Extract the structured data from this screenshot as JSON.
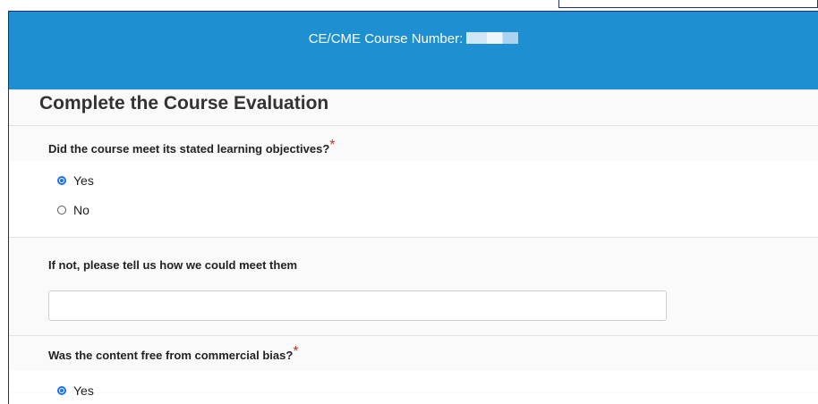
{
  "banner": {
    "course_number_label": "CE/CME Course Number:",
    "course_number_value": "",
    "course_title": ""
  },
  "evaluation": {
    "title": "Complete the Course Evaluation",
    "questions": [
      {
        "label": "Did the course meet its stated learning objectives?",
        "required_mark": "*",
        "options": [
          {
            "label": "Yes",
            "selected": true
          },
          {
            "label": "No",
            "selected": false
          }
        ]
      },
      {
        "label": "If not, please tell us how we could meet them",
        "input_value": "",
        "placeholder": ""
      },
      {
        "label": "Was the content free from commercial bias?",
        "required_mark": "*",
        "options": [
          {
            "label": "Yes",
            "selected": true
          }
        ]
      }
    ]
  },
  "colors": {
    "banner": "#1e90d2",
    "frame": "#1f2f7a",
    "required": "#c0392b",
    "radio_selected": "#1a73e8"
  }
}
